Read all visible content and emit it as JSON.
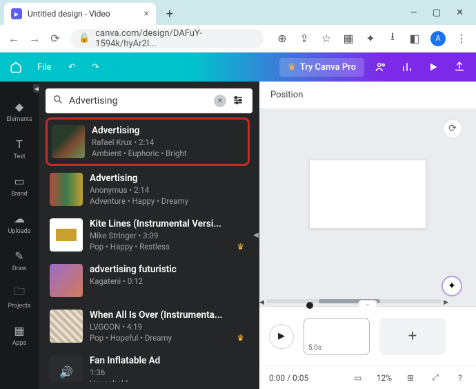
{
  "browser": {
    "tab_title": "Untitled design - Video",
    "url_display": "canva.com/design/DAFuY-1594k/hyAr2I...",
    "avatar_letter": "A"
  },
  "canva_top": {
    "file_label": "File",
    "try_pro_label": "Try Canva Pro"
  },
  "rail": {
    "items": [
      {
        "label": "Elements",
        "icon": "shapes"
      },
      {
        "label": "Text",
        "icon": "text"
      },
      {
        "label": "Brand",
        "icon": "briefcase"
      },
      {
        "label": "Uploads",
        "icon": "cloud-upload"
      },
      {
        "label": "Draw",
        "icon": "pencil"
      },
      {
        "label": "Projects",
        "icon": "folder"
      },
      {
        "label": "Apps",
        "icon": "grid"
      }
    ]
  },
  "search": {
    "value": "Advertising"
  },
  "results": [
    {
      "title": "Advertising",
      "artist_line": "Rafael Krux • 2:14",
      "tags": "Ambient • Euphoric • Bright",
      "premium": false,
      "highlight": true,
      "thumb": "thumb1"
    },
    {
      "title": "Advertising",
      "artist_line": "Anonymus • 2:14",
      "tags": "Adventure • Happy • Dreamy",
      "premium": false,
      "highlight": false,
      "thumb": "thumb2"
    },
    {
      "title": "Kite Lines (Instrumental Versi...",
      "artist_line": "Mike Stringer • 3:09",
      "tags": "Pop • Happy • Restless",
      "premium": true,
      "highlight": false,
      "thumb": "thumb3"
    },
    {
      "title": "advertising futuristic",
      "artist_line": "Kagateni • 0:12",
      "tags": "",
      "premium": false,
      "highlight": false,
      "thumb": "thumb4"
    },
    {
      "title": "When All Is Over (Instrumenta...",
      "artist_line": "LVGOON • 4:19",
      "tags": "Pop • Hopeful • Dreamy",
      "premium": true,
      "highlight": false,
      "thumb": "thumb5"
    },
    {
      "title": "Fan Inflatable Ad",
      "artist_line": "1:36",
      "tags": "Household",
      "premium": false,
      "highlight": false,
      "thumb": "thumb6"
    }
  ],
  "canvas": {
    "position_label": "Position"
  },
  "timeline": {
    "clip_duration": "5.0s",
    "time_display": "0:00 / 0:05",
    "zoom_display": "12%"
  }
}
